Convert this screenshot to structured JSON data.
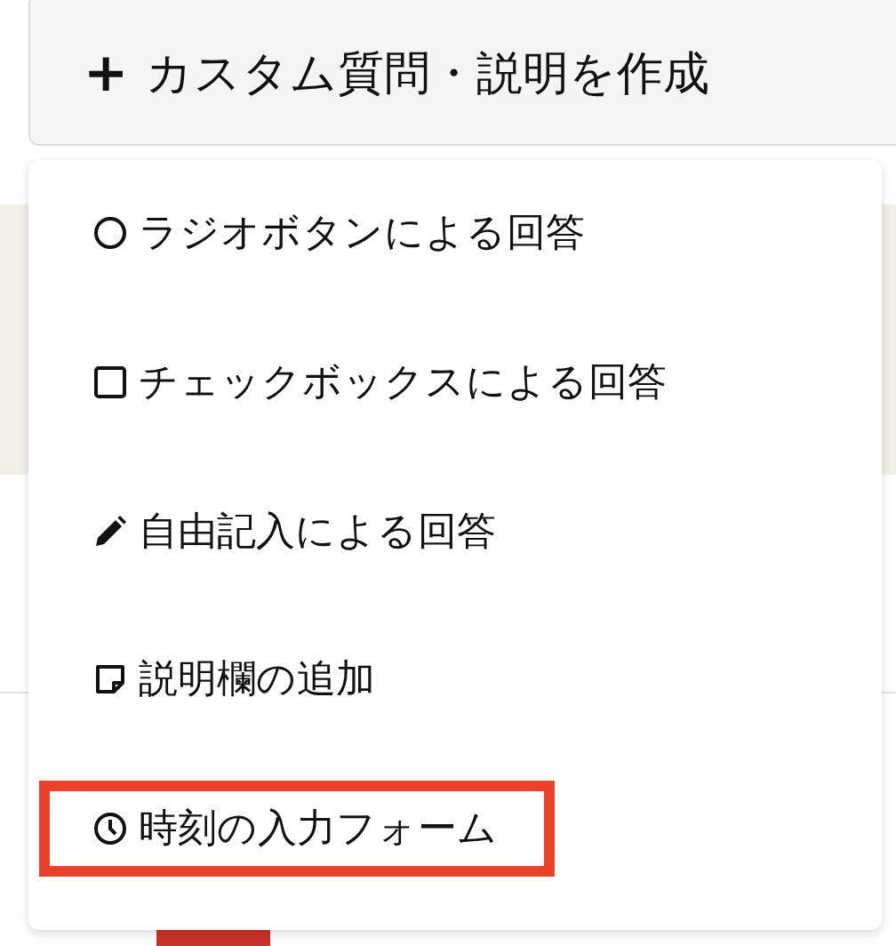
{
  "create_button": {
    "icon": "+",
    "label": "カスタム質問・説明を作成"
  },
  "menu": {
    "items": [
      {
        "kind": "radio",
        "label": "ラジオボタンによる回答",
        "highlighted": false
      },
      {
        "kind": "checkbox",
        "label": "チェックボックスによる回答",
        "highlighted": false
      },
      {
        "kind": "text",
        "label": "自由記入による回答",
        "highlighted": false
      },
      {
        "kind": "note",
        "label": "説明欄の追加",
        "highlighted": false
      },
      {
        "kind": "time",
        "label": "時刻の入力フォーム",
        "highlighted": true
      }
    ]
  }
}
